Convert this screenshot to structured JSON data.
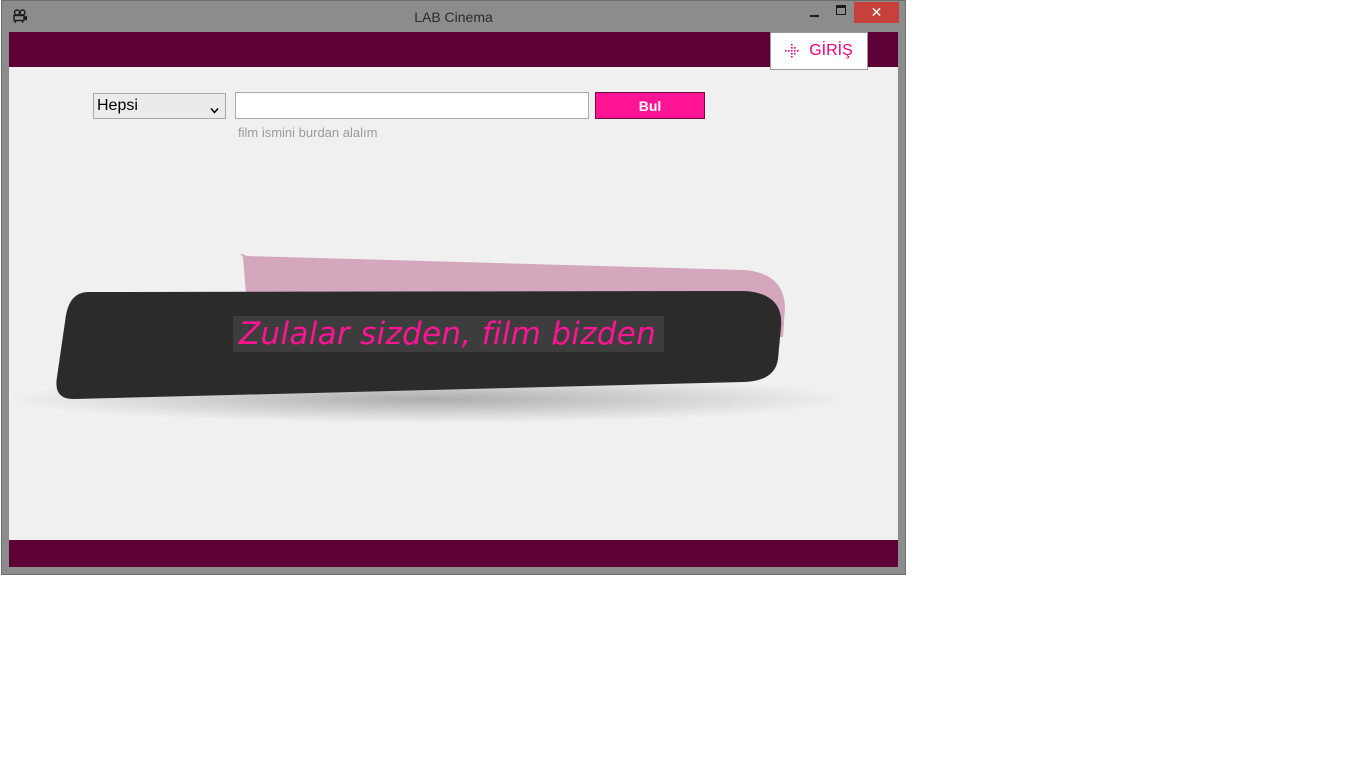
{
  "window": {
    "title": "LAB Cinema",
    "icon": "camera-icon",
    "controls": {
      "minimize_icon": "minimize-icon",
      "maximize_icon": "maximize-icon",
      "close_glyph": "✕"
    }
  },
  "header": {
    "login_label": "GİRİŞ",
    "login_icon": "login-arrow-icon"
  },
  "search": {
    "category_selected": "Hepsi",
    "query_value": "",
    "query_placeholder": "",
    "button_label": "Bul",
    "hint": "film ismini burdan alalım"
  },
  "banner": {
    "slogan": "Zulalar sizden, film bizden"
  },
  "colors": {
    "brand_dark": "#5c0035",
    "accent_pink": "#ff1493",
    "banner_dark": "#2b2b2b",
    "banner_back": "#d4a7bd",
    "background": "#f0f0f0"
  }
}
